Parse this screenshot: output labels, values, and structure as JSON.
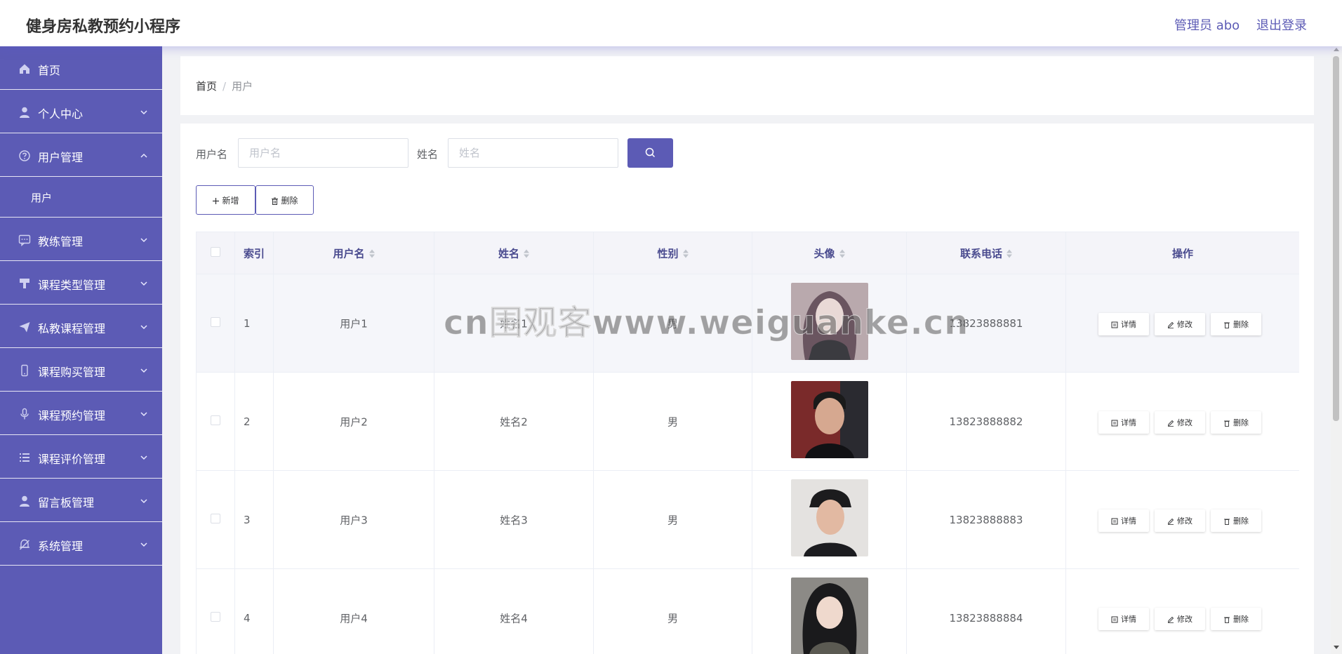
{
  "header": {
    "title": "健身房私教预约小程序",
    "admin": "管理员 abo",
    "logout": "退出登录"
  },
  "sidebar": {
    "items": [
      {
        "label": "首页",
        "icon": "home-icon"
      },
      {
        "label": "个人中心",
        "icon": "user-icon"
      },
      {
        "label": "用户管理",
        "icon": "help-circle-icon",
        "expanded": true
      },
      {
        "label": "教练管理",
        "icon": "chat-icon"
      },
      {
        "label": "课程类型管理",
        "icon": "brush-icon"
      },
      {
        "label": "私教课程管理",
        "icon": "send-icon"
      },
      {
        "label": "课程购买管理",
        "icon": "mobile-icon"
      },
      {
        "label": "课程预约管理",
        "icon": "microphone-icon"
      },
      {
        "label": "课程评价管理",
        "icon": "list-icon"
      },
      {
        "label": "留言板管理",
        "icon": "user-icon"
      },
      {
        "label": "系统管理",
        "icon": "bell-off-icon"
      }
    ],
    "submenu": {
      "label": "用户"
    }
  },
  "breadcrumb": {
    "home": "首页",
    "separator": "/",
    "current": "用户"
  },
  "filters": {
    "username_label": "用户名",
    "username_placeholder": "用户名",
    "name_label": "姓名",
    "name_placeholder": "姓名"
  },
  "actions": {
    "add": "新增",
    "delete": "删除"
  },
  "table": {
    "headers": {
      "index": "索引",
      "username": "用户名",
      "name": "姓名",
      "gender": "性别",
      "avatar": "头像",
      "phone": "联系电话",
      "operations": "操作"
    },
    "op_labels": {
      "detail": "详情",
      "edit": "修改",
      "delete": "删除"
    },
    "rows": [
      {
        "index": "1",
        "username": "用户1",
        "name": "姓名1",
        "gender": "男",
        "phone": "13823888881"
      },
      {
        "index": "2",
        "username": "用户2",
        "name": "姓名2",
        "gender": "男",
        "phone": "13823888882"
      },
      {
        "index": "3",
        "username": "用户3",
        "name": "姓名3",
        "gender": "男",
        "phone": "13823888883"
      },
      {
        "index": "4",
        "username": "用户4",
        "name": "姓名4",
        "gender": "男",
        "phone": "13823888884"
      }
    ]
  },
  "watermark": "cn围观客www.weiguanke.cn",
  "colors": {
    "accent": "#5c5bb5",
    "header_text": "#4a4b8f"
  }
}
